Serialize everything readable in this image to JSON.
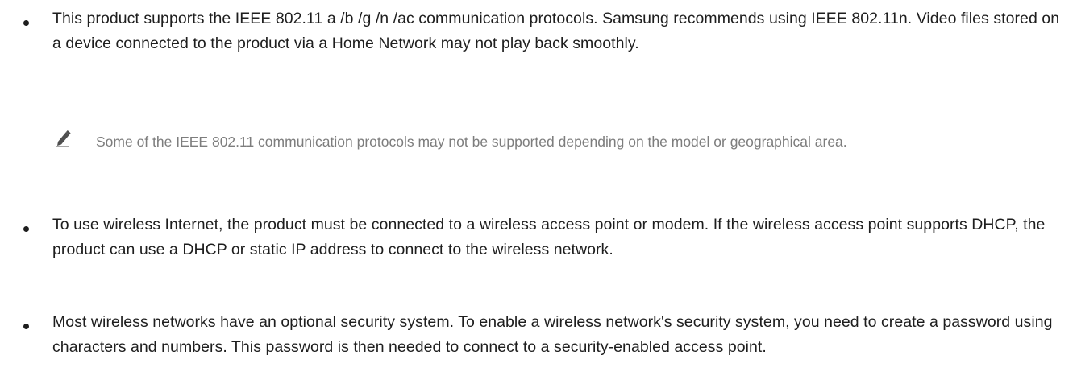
{
  "bullets": [
    {
      "text": "This product supports the IEEE 802.11 a /b /g /n /ac communication protocols. Samsung recommends using IEEE 802.11n. Video files stored on a device connected to the product via a Home Network may not play back smoothly."
    },
    {
      "text": "To use wireless Internet, the product must be connected to a wireless access point or modem. If the wireless access point supports DHCP, the product can use a DHCP or static IP address to connect to the wireless network."
    },
    {
      "text": "Most wireless networks have an optional security system. To enable a wireless network's security system, you need to create a password using characters and numbers. This password is then needed to connect to a security-enabled access point."
    }
  ],
  "note": {
    "icon": "pencil-note-icon",
    "text": "Some of the IEEE 802.11 communication protocols may not be supported depending on the model or geographical area."
  }
}
